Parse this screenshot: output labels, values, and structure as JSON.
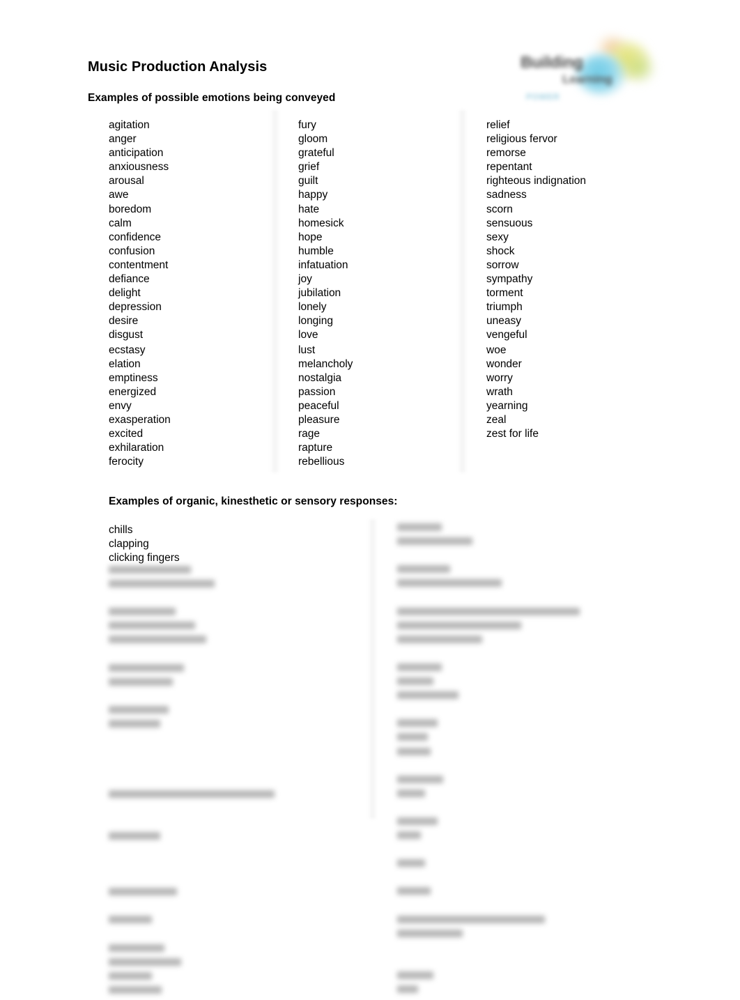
{
  "document": {
    "title": "Music Production Analysis",
    "background_color": "#ffffff",
    "text_color": "#000000"
  },
  "logo": {
    "wordmark": "Building",
    "wordmark_secondary": "Learning",
    "tagline": "POWER",
    "colors": {
      "blue": "#6fcbe6",
      "yellow": "#dfe06a",
      "green": "#bad66c",
      "orange": "#edba7a",
      "wordmark_gray": "#4a4a4a",
      "tagline_blue": "#9ecfe0"
    }
  },
  "sections": [
    {
      "heading": "Examples of possible emotions being conveyed",
      "columns": [
        {
          "items": [
            "agitation",
            "anger",
            "anticipation",
            "anxiousness",
            "arousal",
            "awe",
            "boredom",
            "calm",
            "confidence",
            "confusion",
            "contentment",
            "defiance",
            "delight",
            "depression",
            "desire",
            "disgust",
            "ecstasy",
            "elation",
            "emptiness",
            "energized",
            "envy",
            "exasperation",
            "excited",
            "exhilaration",
            "ferocity"
          ]
        },
        {
          "items": [
            "fury",
            "gloom",
            "grateful",
            "grief",
            "guilt",
            "happy",
            "hate",
            "homesick",
            "hope",
            "humble",
            "infatuation",
            "joy",
            "jubilation",
            "lonely",
            "longing",
            "love",
            "lust",
            "melancholy",
            "nostalgia",
            "passion",
            "peaceful",
            "pleasure",
            "rage",
            "rapture",
            "rebellious"
          ]
        },
        {
          "items": [
            "relief",
            "religious fervor",
            "remorse",
            "repentant",
            "righteous indignation",
            "sadness",
            "scorn",
            "sensuous",
            "sexy",
            "shock",
            "sorrow",
            "sympathy",
            "torment",
            "triumph",
            "uneasy",
            "vengeful",
            "woe",
            "wonder",
            "worry",
            "wrath",
            "yearning",
            "zeal",
            "zest for life"
          ]
        }
      ]
    },
    {
      "heading": "Examples of organic, kinesthetic or sensory responses:",
      "visible_items": [
        "chills",
        "clapping",
        "clicking fingers"
      ],
      "redacted_note": "remaining entries are blurred and illegible",
      "redacted_left_widths": [
        118,
        152,
        0,
        96,
        124,
        140,
        0,
        108,
        92,
        0,
        86,
        74,
        0,
        0,
        0,
        0,
        238,
        0,
        0,
        74,
        0,
        0,
        0,
        98,
        0,
        62,
        0,
        80,
        104,
        62,
        76
      ],
      "redacted_right_widths": [
        64,
        108,
        0,
        76,
        150,
        0,
        262,
        178,
        122,
        0,
        64,
        52,
        88,
        0,
        58,
        44,
        48,
        0,
        66,
        40,
        0,
        58,
        34,
        0,
        40,
        0,
        48,
        0,
        212,
        94,
        0,
        0,
        52,
        30
      ]
    }
  ]
}
